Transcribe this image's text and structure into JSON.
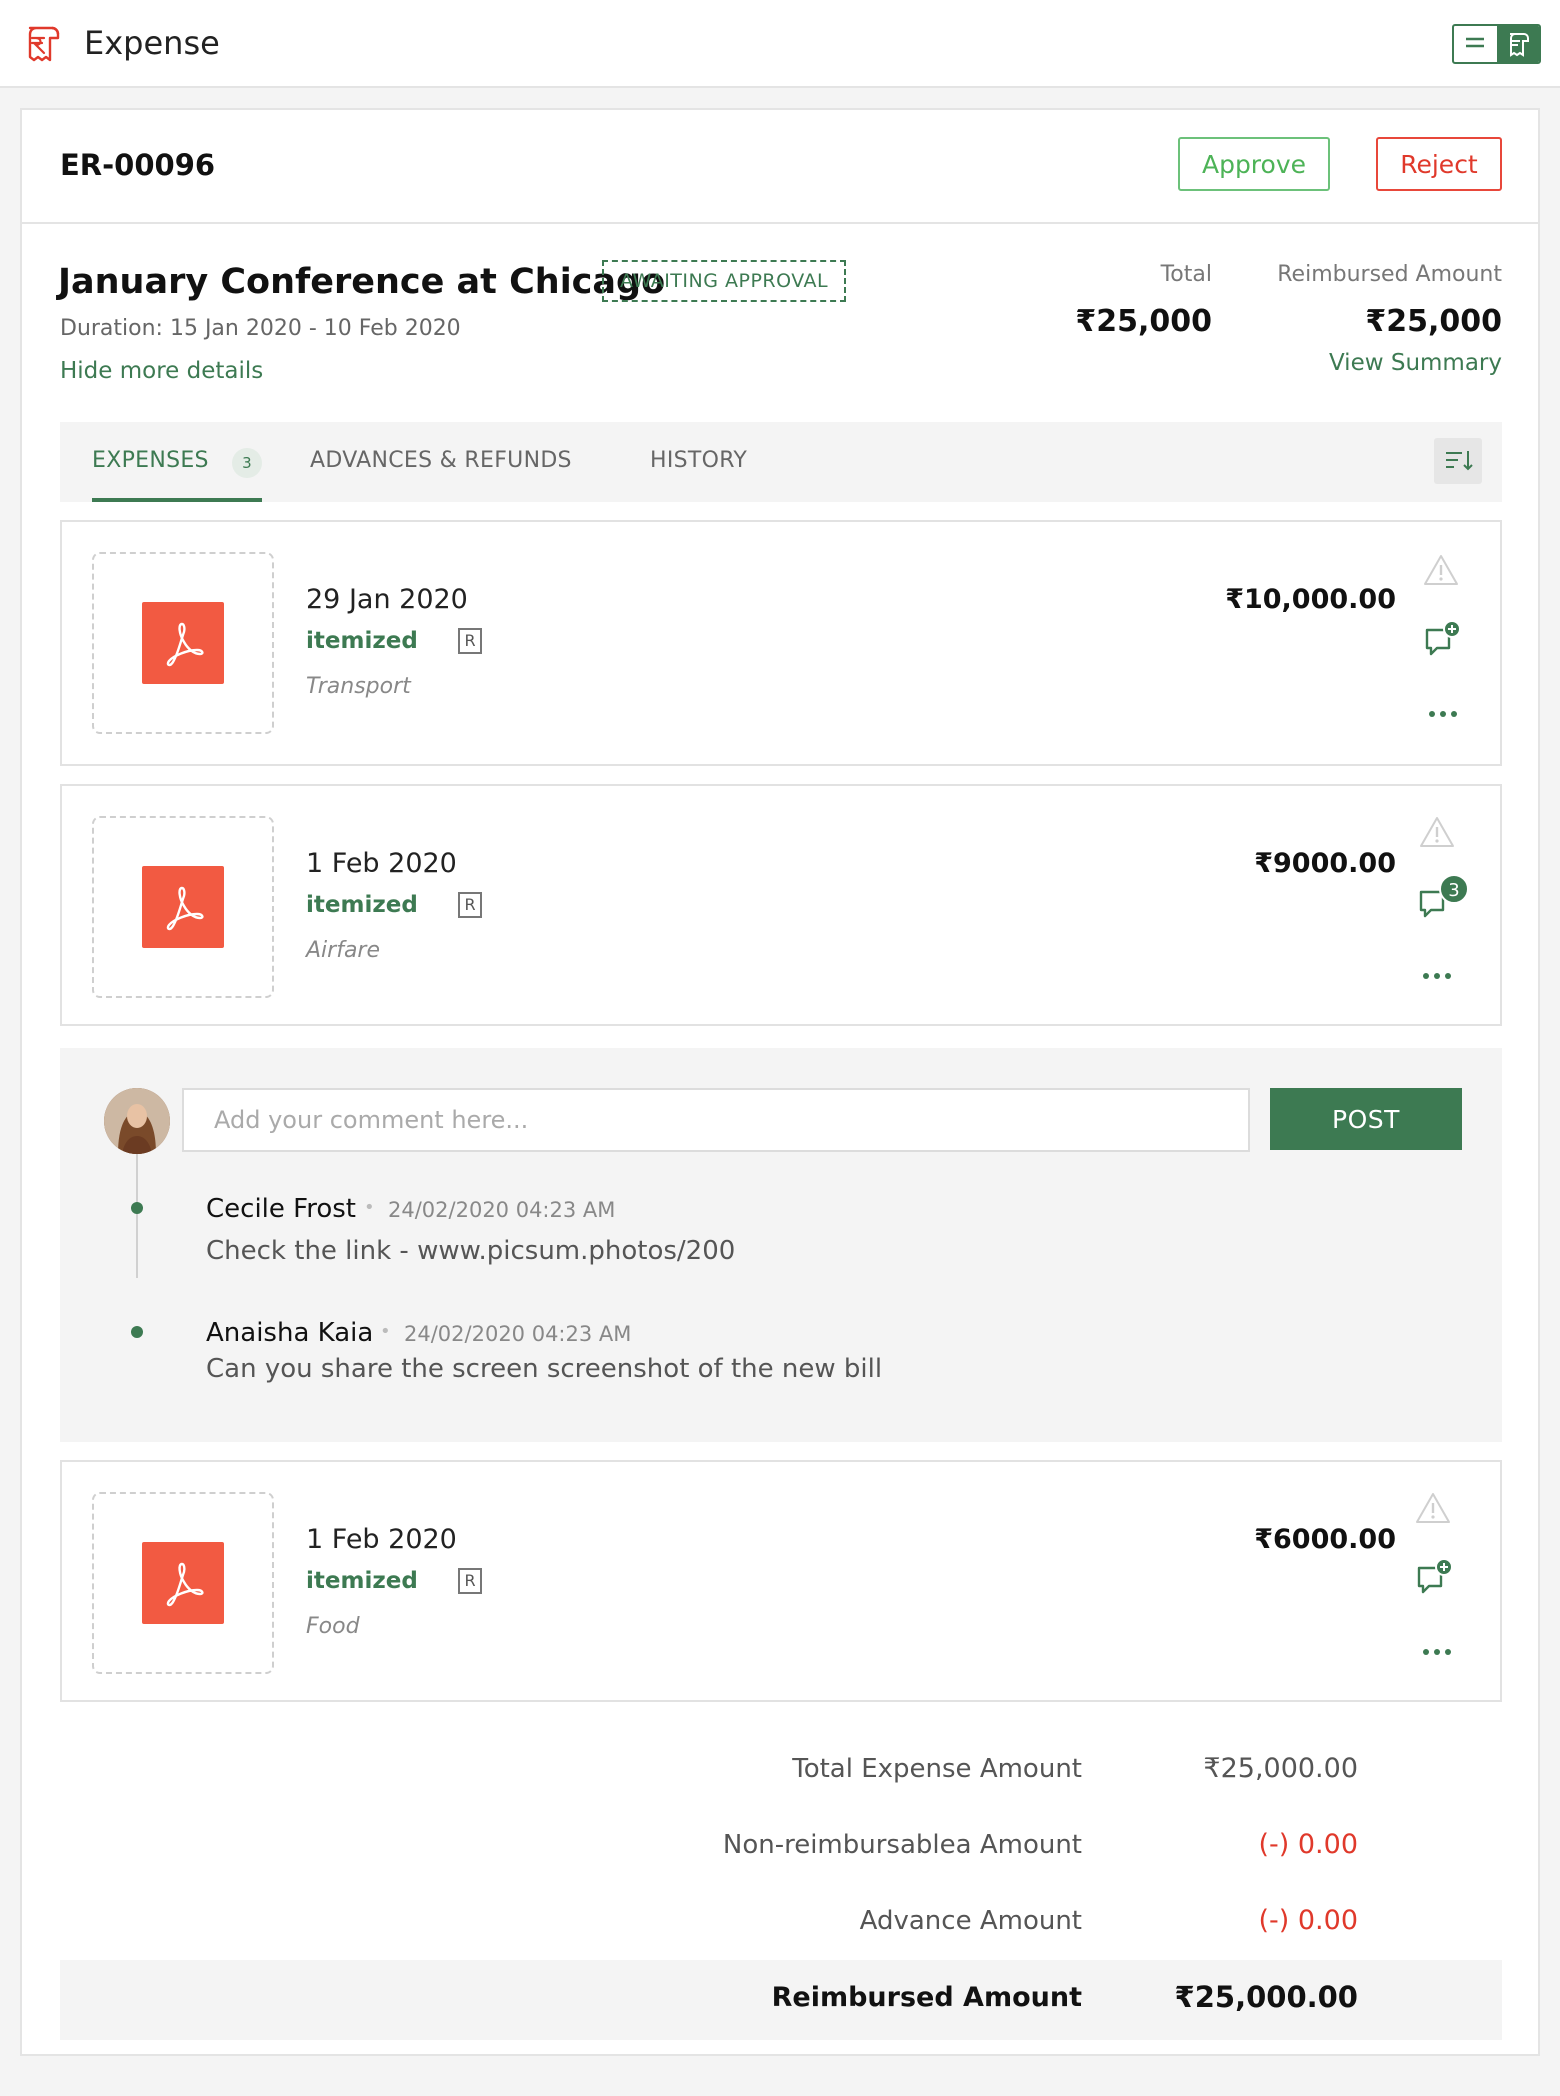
{
  "app": {
    "title": "Expense",
    "logo_icon": "receipt-icon",
    "accent": "#3d7a52"
  },
  "header": {
    "report_id": "ER-00096",
    "approve_label": "Approve",
    "reject_label": "Reject"
  },
  "trip": {
    "title": "January Conference at Chicago",
    "status": "AWAITING APPROVAL",
    "duration": "Duration: 15 Jan 2020 - 10 Feb 2020",
    "hide_details": "Hide more details",
    "total_label": "Total",
    "total_value": "₹25,000",
    "reimbursed_label": "Reimbursed Amount",
    "reimbursed_value": "₹25,000",
    "view_summary": "View Summary"
  },
  "tabs": [
    {
      "label": "EXPENSES",
      "count": "3",
      "active": true
    },
    {
      "label": "ADVANCES & REFUNDS"
    },
    {
      "label": "HISTORY"
    }
  ],
  "expenses": [
    {
      "date": "29 Jan 2020",
      "type": "itemized",
      "badge": "R",
      "category": "Transport",
      "amount": "₹10,000.00",
      "comments": ""
    },
    {
      "date": "1 Feb 2020",
      "type": "itemized",
      "badge": "R",
      "category": "Airfare",
      "amount": "₹9000.00",
      "comments": "3"
    },
    {
      "date": "1 Feb 2020",
      "type": "itemized",
      "badge": "R",
      "category": "Food",
      "amount": "₹6000.00",
      "comments": ""
    }
  ],
  "comments": {
    "placeholder": "Add your comment here...",
    "post_label": "POST",
    "items": [
      {
        "author": "Cecile Frost",
        "time": "24/02/2020 04:23 AM",
        "text": "Check the link - www.picsum.photos/200"
      },
      {
        "author": "Anaisha Kaia",
        "time": "24/02/2020 04:23 AM",
        "text": "Can you share the screen screenshot of the new bill"
      }
    ]
  },
  "summary": {
    "rows": [
      {
        "label": "Total Expense Amount",
        "value": "₹25,000.00"
      },
      {
        "label": "Non-reimbursablea Amount",
        "value": "(-) 0.00"
      },
      {
        "label": "Advance Amount",
        "value": "(-) 0.00"
      }
    ],
    "total_label": "Reimbursed Amount",
    "total_value": "₹25,000.00"
  }
}
